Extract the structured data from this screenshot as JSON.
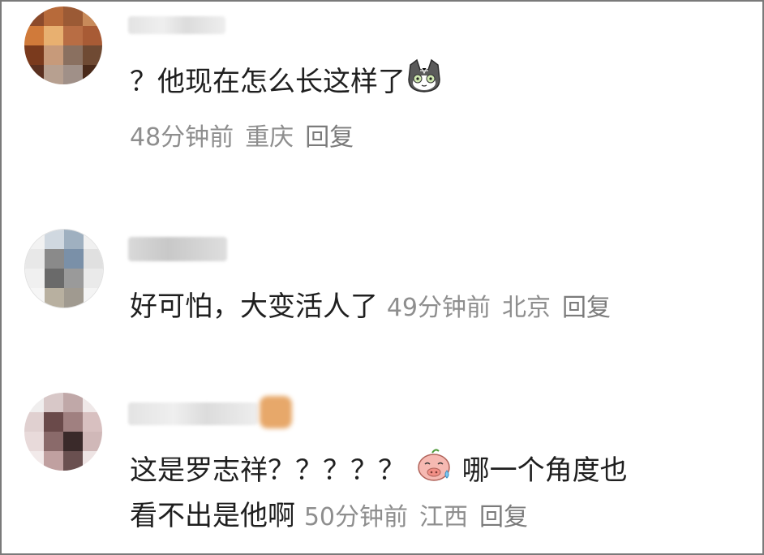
{
  "comments": [
    {
      "text": "？他现在怎么长这样了",
      "emoji": "cat-sticker",
      "time": "48分钟前",
      "location": "重庆",
      "reply": "回复"
    },
    {
      "text": "好可怕，大变活人了",
      "time": "49分钟前",
      "location": "北京",
      "reply": "回复"
    },
    {
      "text_line1": "这是罗志祥？？？？？",
      "emoji": "pig-sweat-sticker",
      "text_line1_tail": "哪一个角度也",
      "text_line2": "看不出是他啊",
      "time": "50分钟前",
      "location": "江西",
      "reply": "回复"
    }
  ],
  "colors": {
    "text": "#1f1f1f",
    "meta": "#8e8e8e",
    "border": "#7a7a7a"
  }
}
